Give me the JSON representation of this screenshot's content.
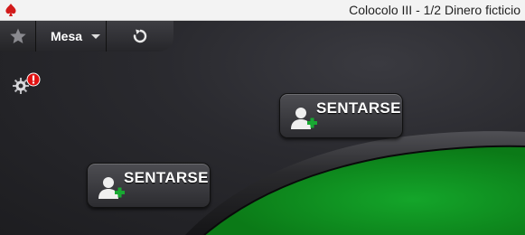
{
  "window": {
    "title": "Colocolo III - 1/2 Dinero ficticio"
  },
  "toolbar": {
    "menu_label": "Mesa"
  },
  "seats": [
    {
      "label": "SENTARSE"
    },
    {
      "label": "SENTARSE"
    }
  ],
  "colors": {
    "felt": "#0f8a1d",
    "felt_rail": "#2b2b2e",
    "alert": "#e01010",
    "plus": "#18a832"
  },
  "icons": {
    "app": "poker-spade-icon",
    "favorite": "star-icon",
    "menu_dropdown": "chevron-down-icon",
    "refresh": "refresh-icon",
    "settings": "gear-icon",
    "alert": "exclamation-badge-icon",
    "seat": "add-player-icon"
  }
}
